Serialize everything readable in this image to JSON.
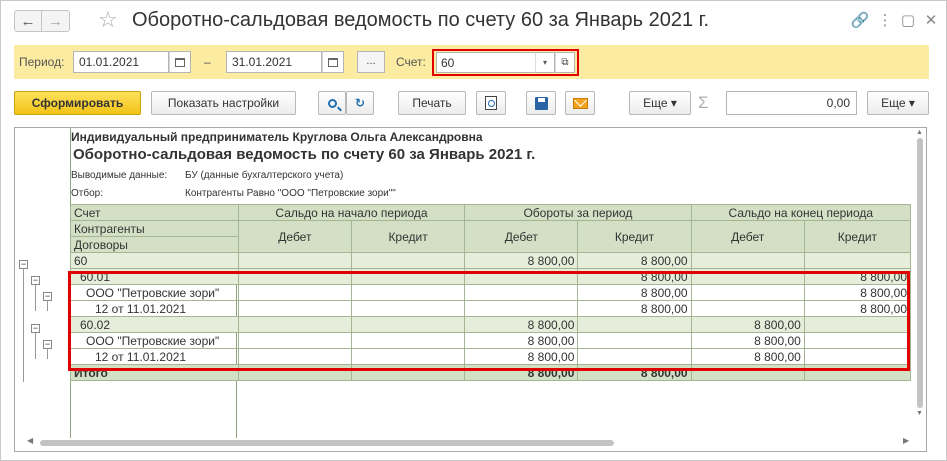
{
  "window": {
    "title": "Оборотно-сальдовая ведомость по счету 60 за Январь 2021 г.",
    "nav": {
      "back": "←",
      "forward": "→",
      "favorite": "☆"
    },
    "icons": {
      "link": "🔗",
      "more": "⋮",
      "maximize": "▢",
      "close": "✕"
    }
  },
  "params": {
    "period_label": "Период:",
    "date_from": "01.01.2021",
    "dash": "–",
    "date_to": "31.01.2021",
    "choose_period": "...",
    "account_label": "Счет:",
    "account_value": "60",
    "dropdown_glyph": "▾",
    "open_glyph": "⧉"
  },
  "toolbar": {
    "generate": "Сформировать",
    "settings": "Показать настройки",
    "print": "Печать",
    "more1": "Еще ▾",
    "sigma": "Σ",
    "sum_value": "0,00",
    "more2": "Еще ▾",
    "refresh_glyph": "↻"
  },
  "report": {
    "org": "Индивидуальный предприниматель Круглова Ольга Александровна",
    "title": "Оборотно-сальдовая ведомость по счету 60 за Январь 2021 г.",
    "data_label": "Выводимые данные:",
    "data_value": "БУ (данные бухгалтерского учета)",
    "filter_label": "Отбор:",
    "filter_value": "Контрагенты Равно \"ООО \"Петровские зори\"\"",
    "headers": {
      "account": "Счет",
      "counterparties": "Контрагенты",
      "contracts": "Договоры",
      "opening": "Сальдо на начало периода",
      "turnover": "Обороты за период",
      "closing": "Сальдо на конец периода",
      "debit": "Дебет",
      "credit": "Кредит"
    },
    "rows": [
      {
        "label": "60",
        "values": [
          "",
          "",
          "8 800,00",
          "8 800,00",
          "",
          ""
        ]
      },
      {
        "label": "60.01",
        "values": [
          "",
          "",
          "",
          "8 800,00",
          "",
          "8 800,00"
        ]
      },
      {
        "label": "ООО \"Петровские зори\"",
        "values": [
          "",
          "",
          "",
          "8 800,00",
          "",
          "8 800,00"
        ]
      },
      {
        "label": "12 от 11.01.2021",
        "values": [
          "",
          "",
          "",
          "8 800,00",
          "",
          "8 800,00"
        ]
      },
      {
        "label": "60.02",
        "values": [
          "",
          "",
          "8 800,00",
          "",
          "8 800,00",
          ""
        ]
      },
      {
        "label": "ООО \"Петровские зори\"",
        "values": [
          "",
          "",
          "8 800,00",
          "",
          "8 800,00",
          ""
        ]
      },
      {
        "label": "12 от 11.01.2021",
        "values": [
          "",
          "",
          "8 800,00",
          "",
          "8 800,00",
          ""
        ]
      }
    ],
    "total": {
      "label": "Итого",
      "values": [
        "",
        "",
        "8 800,00",
        "8 800,00",
        "",
        ""
      ]
    },
    "tree_glyph": "−"
  },
  "colors": {
    "accent_yellow": "#f2c317",
    "param_bar": "#fbeca2",
    "header_green": "#d3e0c5",
    "highlight_red": "#e00000"
  }
}
